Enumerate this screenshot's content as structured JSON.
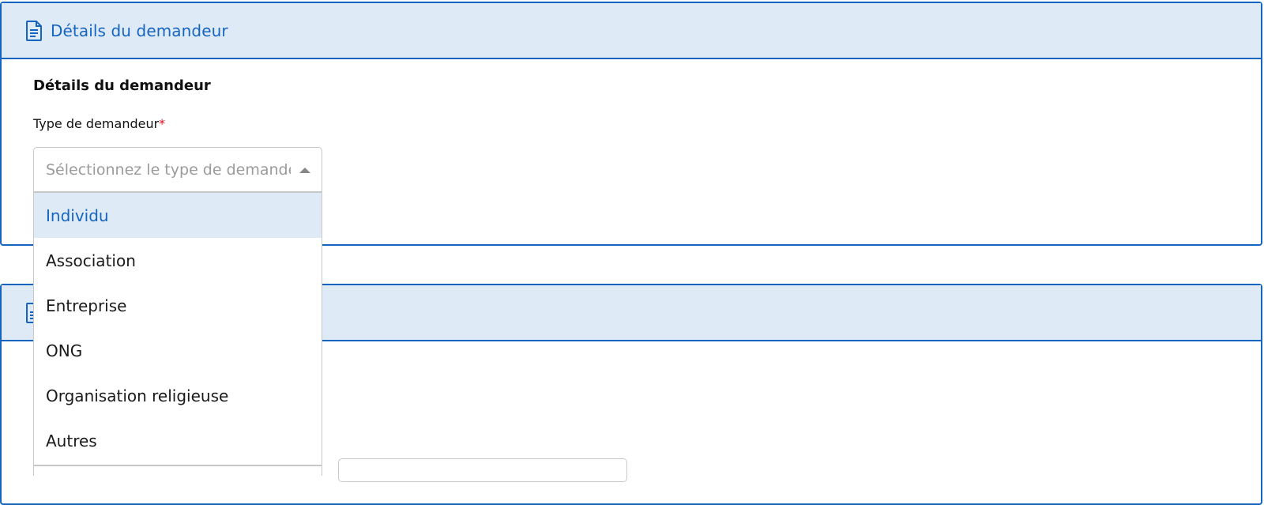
{
  "panel1": {
    "header_title": "Détails du demandeur",
    "section_title": "Détails du demandeur",
    "field_label": "Type de demandeur",
    "required_mark": "*",
    "select_placeholder": "Sélectionnez le type de demandeur",
    "options": [
      "Individu",
      "Association",
      "Entreprise",
      "ONG",
      "Organisation religieuse",
      "Autres"
    ],
    "selected_highlight": "Individu"
  },
  "panel2": {
    "header_title": ""
  },
  "colors": {
    "accent": "#1565c0",
    "header_bg": "#dfeaf7",
    "required": "#e3101d"
  },
  "icons": {
    "header": "document-icon",
    "caret": "caret-up-icon"
  }
}
